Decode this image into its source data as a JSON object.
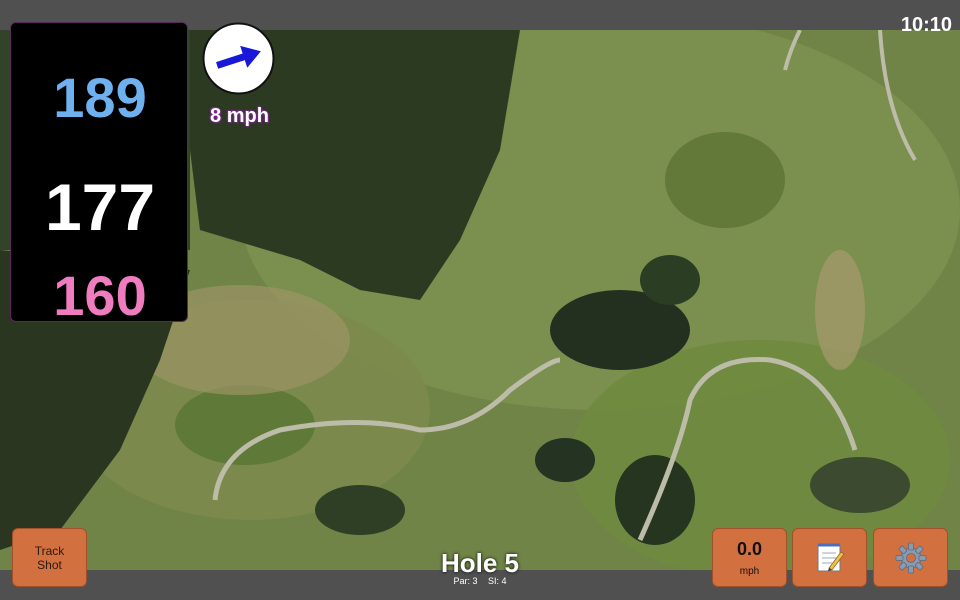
{
  "status_bar": {
    "time": "10:10"
  },
  "distances": {
    "back": "189",
    "middle": "177",
    "front": "160"
  },
  "wind": {
    "speed_label": "8 mph",
    "icon": "wind-arrow-icon",
    "direction": "east-northeast"
  },
  "hole": {
    "title": "Hole 5",
    "par_label": "Par: 3",
    "si_label": "SI: 4"
  },
  "buttons": {
    "track_shot_line1": "Track",
    "track_shot_line2": "Shot",
    "speed_value": "0.0",
    "speed_unit": "mph",
    "notes_icon": "notepad-icon",
    "settings_icon": "gear-icon"
  },
  "colors": {
    "back_distance": "#6fb0ef",
    "middle_distance": "#ffffff",
    "front_distance": "#f07cc0",
    "button_bg": "#d2703f",
    "wind_arrow": "#1a18d8"
  }
}
